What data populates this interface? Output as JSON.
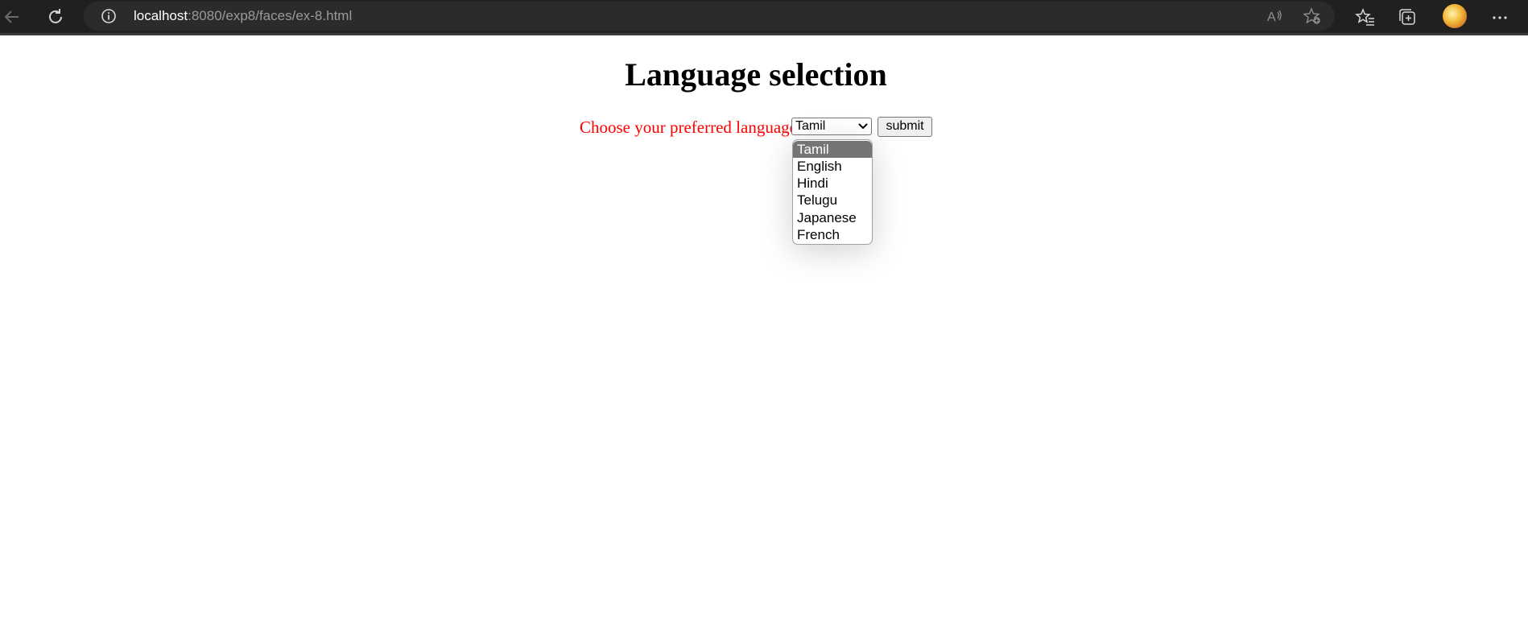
{
  "browser": {
    "url_host": "localhost",
    "url_path": ":8080/exp8/faces/ex-8.html",
    "icons": [
      "back-icon",
      "refresh-icon",
      "site-info-icon",
      "read-aloud-icon",
      "add-favorite-icon",
      "favorites-icon",
      "collections-icon",
      "profile-avatar",
      "more-icon"
    ]
  },
  "page": {
    "title": "Language selection",
    "prompt": "Choose your preferred language",
    "prompt_color": "#ff0000",
    "select_value": "Tamil",
    "submit_label": "submit",
    "options": [
      "Tamil",
      "English",
      "Hindi",
      "Telugu",
      "Japanese",
      "French"
    ],
    "highlighted_option": "Tamil"
  }
}
